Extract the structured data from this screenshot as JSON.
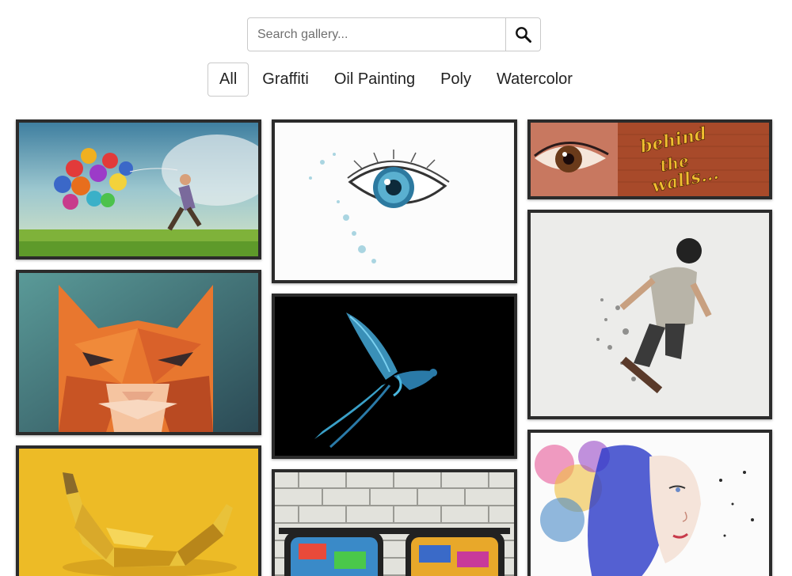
{
  "search": {
    "placeholder": "Search gallery...",
    "icon": "search-icon"
  },
  "filters": [
    {
      "label": "All",
      "active": true
    },
    {
      "label": "Graffiti",
      "active": false
    },
    {
      "label": "Oil Painting",
      "active": false
    },
    {
      "label": "Poly",
      "active": false
    },
    {
      "label": "Watercolor",
      "active": false
    }
  ],
  "gallery": {
    "items": [
      {
        "subject": "balloon-child-oil-painting"
      },
      {
        "subject": "watercolor-eye"
      },
      {
        "subject": "graffiti-eye-behind-the-walls",
        "text": "behind the walls..."
      },
      {
        "subject": "poly-cat"
      },
      {
        "subject": "blue-bird-on-black"
      },
      {
        "subject": "skateboarder-dispersion"
      },
      {
        "subject": "poly-banana"
      },
      {
        "subject": "graffiti-glasses-brick-wall"
      },
      {
        "subject": "watercolor-woman-face"
      }
    ]
  },
  "colors": {
    "tile_border": "#2b2b2b",
    "button_border": "#c9c9c9"
  }
}
